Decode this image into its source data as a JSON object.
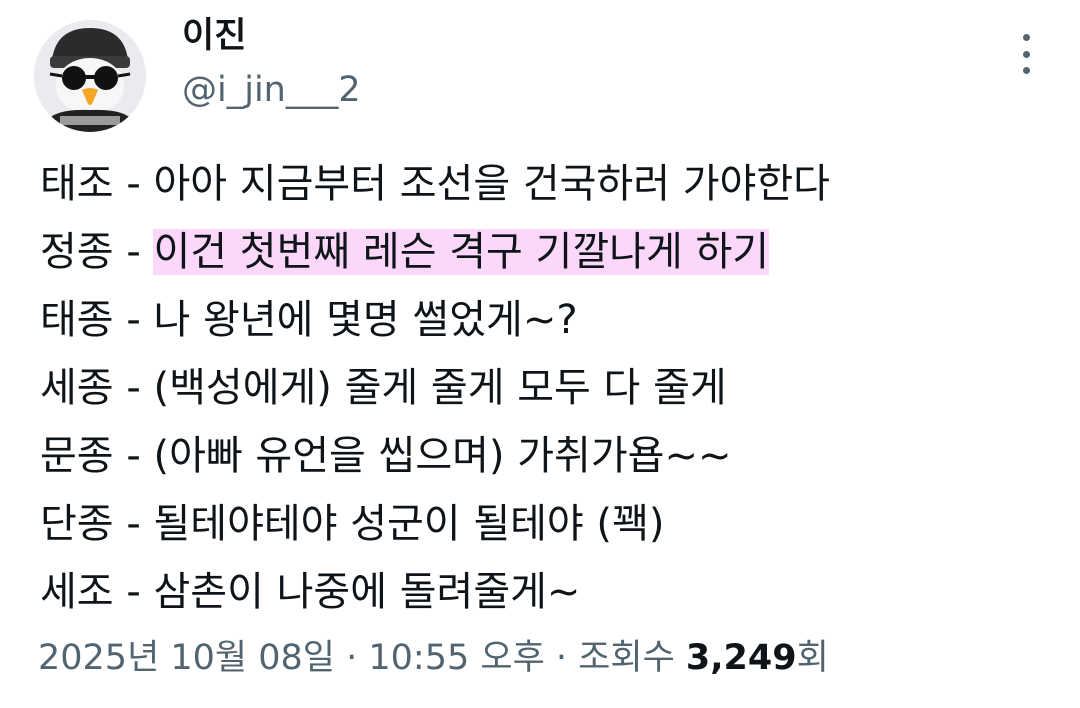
{
  "author": {
    "display_name": "이진",
    "handle": "@i_jin___2",
    "avatar_icon": "penguin-with-sunglasses-avatar"
  },
  "more_icon": "more-options-icon",
  "lines": [
    {
      "name": "태조",
      "sep": " - ",
      "text": "아아 지금부터 조선을 건국하러 가야한다",
      "highlight": false
    },
    {
      "name": "정종",
      "sep": " - ",
      "text": "이건 첫번째 레슨 격구 기깔나게 하기",
      "highlight": true
    },
    {
      "name": "태종",
      "sep": " - ",
      "text": "나 왕년에 몇명 썰었게~?",
      "highlight": false
    },
    {
      "name": "세종",
      "sep": " - ",
      "text": "(백성에게) 줄게 줄게 모두 다 줄게",
      "highlight": false
    },
    {
      "name": "문종",
      "sep": " - ",
      "text": "(아빠 유언을 씹으며) 가취가욥~~",
      "highlight": false
    },
    {
      "name": "단종",
      "sep": " - ",
      "text": "될테야테야 성군이 될테야 (꽥)",
      "highlight": false
    },
    {
      "name": "세조",
      "sep": " - ",
      "text": "삼촌이 나중에 돌려줄게~",
      "highlight": false
    }
  ],
  "highlight_color": "#fbd7fa",
  "meta": {
    "date": "2025년 10월 08일",
    "dot1": " · ",
    "time": "10:55 오후",
    "dot2": " · ",
    "views_label": "조회수 ",
    "views_count": "3,249",
    "views_suffix": "회"
  }
}
